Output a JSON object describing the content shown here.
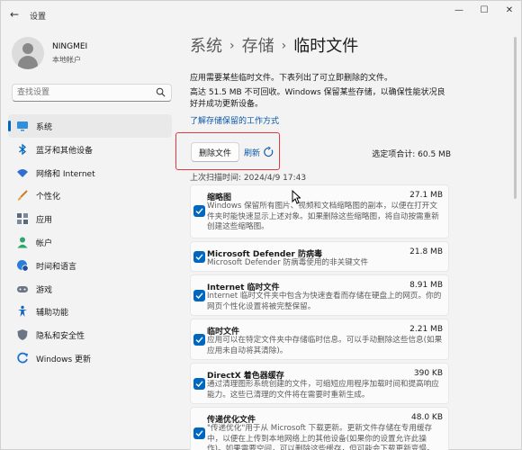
{
  "window": {
    "title": "设置"
  },
  "profile": {
    "name": "NINGMEI",
    "account_type": "本地帐户"
  },
  "search": {
    "placeholder": "查找设置"
  },
  "sidebar": {
    "items": [
      {
        "label": "系统",
        "icon": "monitor-icon",
        "selected": true
      },
      {
        "label": "蓝牙和其他设备",
        "icon": "bluetooth-icon"
      },
      {
        "label": "网络和 Internet",
        "icon": "wifi-icon"
      },
      {
        "label": "个性化",
        "icon": "paintbrush-icon"
      },
      {
        "label": "应用",
        "icon": "apps-icon"
      },
      {
        "label": "帐户",
        "icon": "person-icon"
      },
      {
        "label": "时间和语言",
        "icon": "globe-clock-icon"
      },
      {
        "label": "游戏",
        "icon": "gamepad-icon"
      },
      {
        "label": "辅助功能",
        "icon": "accessibility-icon"
      },
      {
        "label": "隐私和安全性",
        "icon": "shield-icon"
      },
      {
        "label": "Windows 更新",
        "icon": "update-icon"
      }
    ]
  },
  "breadcrumb": {
    "level1": "系统",
    "level2": "存储",
    "current": "临时文件",
    "separator": "›"
  },
  "main": {
    "intro": "应用需要某些临时文件。下表列出了可立即删除的文件。",
    "warning": "高达 51.5 MB 不可回收。Windows 保留某些存储，以确保性能状况良好并成功更新设备。",
    "learn_link": "了解存储保留的工作方式",
    "delete_button": "删除文件",
    "refresh_button": "刷新",
    "selected_total": "选定项合计: 60.5 MB",
    "last_scan": "上次扫描时间: 2024/4/9 17:43"
  },
  "files": [
    {
      "title": "缩略图",
      "size": "27.1 MB",
      "checked": true,
      "description": "Windows 保留所有图片、视频和文档缩略图的副本，以便在打开文件夹时能快速显示上述对象。如果删除这些缩略图，将自动按需重新创建这些缩略图。"
    },
    {
      "title": "Microsoft Defender 防病毒",
      "size": "21.8 MB",
      "checked": true,
      "description": "Microsoft Defender 防病毒使用的非关键文件"
    },
    {
      "title": "Internet 临时文件",
      "size": "8.91 MB",
      "checked": true,
      "description": "Internet 临时文件夹中包含为快速查看而存储在硬盘上的网页。你的网页个性化设置将被完整保留。"
    },
    {
      "title": "临时文件",
      "size": "2.21 MB",
      "checked": true,
      "description": "应用可以在特定文件夹中存储临时信息。可以手动删除这些信息(如果应用未自动将其清除)。"
    },
    {
      "title": "DirectX 着色器缓存",
      "size": "390 KB",
      "checked": true,
      "description": "通过清理图形系统创建的文件，可缩短应用程序加载时间和提高响应能力。这些已清理的文件将在需要时重新生成。"
    },
    {
      "title": "传递优化文件",
      "size": "48.0 KB",
      "checked": true,
      "description": "\"传递优化\"用于从 Microsoft 下载更新。更新文件存储在专用缓存中，以便在上传到本地网络上的其他设备(如果你的设置允许此操作)。如果需要空间，可以删除这些缓存，但可能会下载更新变慢。"
    }
  ]
}
